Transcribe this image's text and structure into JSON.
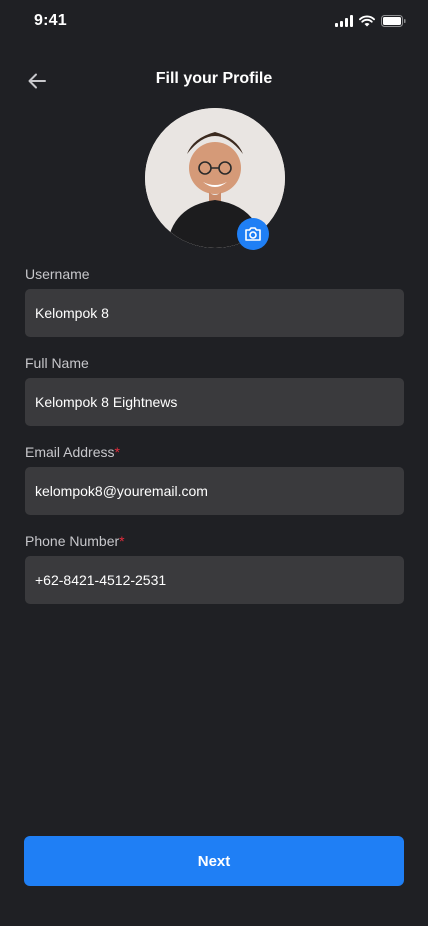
{
  "status_bar": {
    "time": "9:41",
    "icons": [
      "signal-icon",
      "wifi-icon",
      "battery-icon"
    ]
  },
  "header": {
    "title": "Fill your Profile",
    "back_icon": "arrow-left-icon"
  },
  "profile": {
    "camera_icon": "camera-icon"
  },
  "form": {
    "required_mark": "*",
    "fields": [
      {
        "label": "Username",
        "value": "Kelompok 8",
        "required": false
      },
      {
        "label": "Full Name",
        "value": "Kelompok 8 Eightnews",
        "required": false
      },
      {
        "label": "Email Address",
        "value": "kelompok8@youremail.com",
        "required": true
      },
      {
        "label": "Phone Number",
        "value": "+62-8421-4512-2531",
        "required": true
      }
    ]
  },
  "actions": {
    "next_label": "Next"
  },
  "colors": {
    "background": "#1f2024",
    "input_background": "#3a3a3d",
    "accent": "#1f7ff5",
    "required": "#e32d3d"
  }
}
